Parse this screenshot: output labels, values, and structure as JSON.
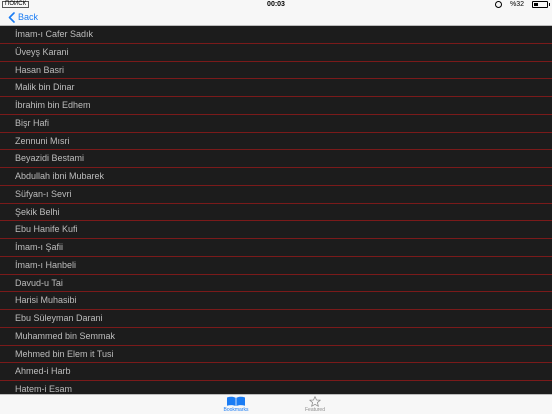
{
  "status_bar": {
    "carrier": "ПОИСК",
    "time": "00:03",
    "battery": "%32",
    "battery_level": 0.32
  },
  "nav": {
    "back_label": "Back"
  },
  "list": {
    "items": [
      "İmam-ı Cafer Sadık",
      "Üveyş Karani",
      "Hasan Basri",
      "Malik bin Dinar",
      "İbrahim bin Edhem",
      "Bişr Hafi",
      "Zennuni Mısri",
      "Beyazidi Bestami",
      "Abdullah ibni Mubarek",
      "Süfyan-ı Sevri",
      "Şekik Belhi",
      "Ebu Hanife Kufi",
      "İmam-ı Şafii",
      "İmam-ı Hanbeli",
      "Davud-u Tai",
      "Harisi Muhasibi",
      "Ebu Süleyman Darani",
      "Muhammed bin Semmak",
      "Mehmed bin Elem it Tusi",
      "Ahmed-i Harb",
      "Hatem-i Esam"
    ]
  },
  "tab_bar": {
    "tabs": [
      {
        "label": "Bookmarks",
        "icon": "book-icon",
        "selected": true
      },
      {
        "label": "Featured",
        "icon": "star-icon",
        "selected": false
      }
    ],
    "colors": {
      "selected": "#1a7cf4",
      "unselected": "#8e8e8e"
    }
  }
}
